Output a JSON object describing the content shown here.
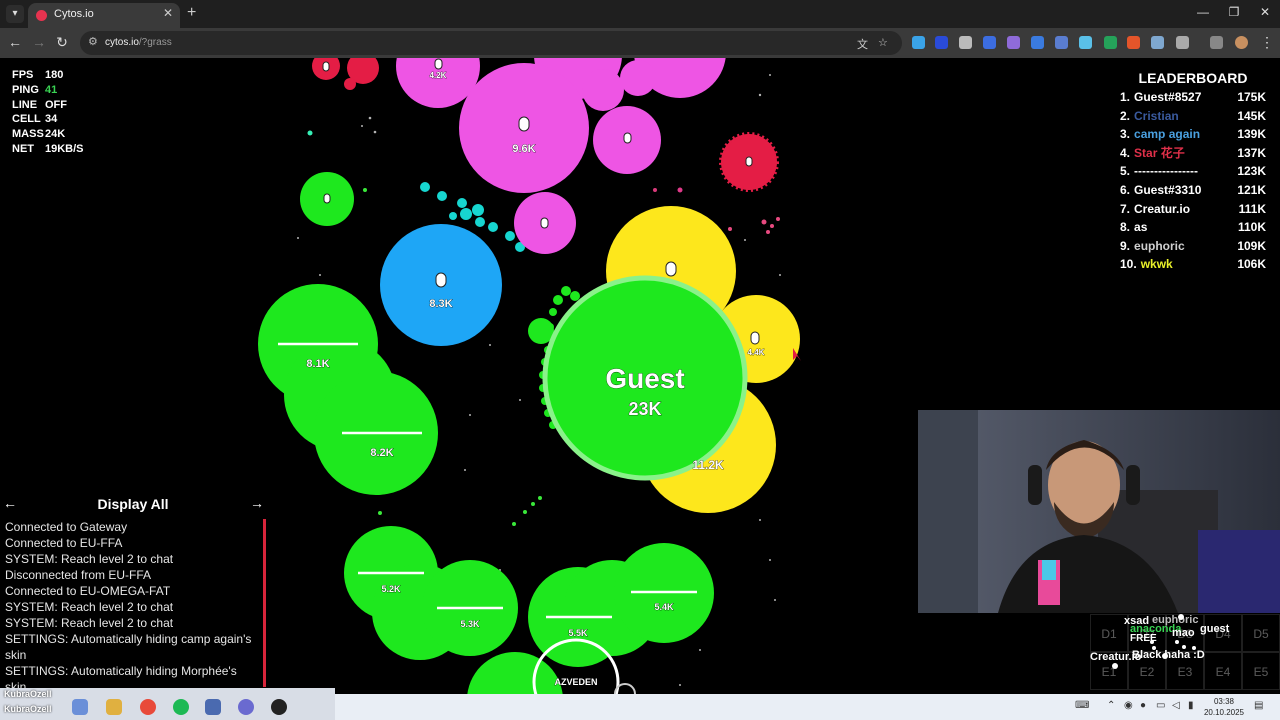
{
  "browser": {
    "tab_title": "Cytos.io",
    "tab_close": "✕",
    "new_tab": "+",
    "url_host": "cytos.io",
    "url_path": "/?grass",
    "back": "←",
    "forward": "→",
    "reload": "↻",
    "minimize": "—",
    "restore": "❐",
    "close": "✕"
  },
  "stats": [
    {
      "label": "FPS",
      "value": "180"
    },
    {
      "label": "PING",
      "value": "41"
    },
    {
      "label": "LINE",
      "value": "OFF"
    },
    {
      "label": "CELL",
      "value": "34"
    },
    {
      "label": "MASS",
      "value": "24K"
    },
    {
      "label": "NET",
      "value": "19KB/S"
    }
  ],
  "leaderboard": {
    "title": "LEADERBOARD",
    "entries": [
      {
        "rank": "1.",
        "name": "Guest#8527",
        "score": "175K",
        "color": "#ffffff"
      },
      {
        "rank": "2.",
        "name": "Cristian",
        "score": "145K",
        "color": "#3a5a9e"
      },
      {
        "rank": "3.",
        "name": "camp again",
        "score": "139K",
        "color": "#4aa0e0"
      },
      {
        "rank": "4.",
        "name": "Star 花子",
        "score": "137K",
        "color": "#e0304a"
      },
      {
        "rank": "5.",
        "name": "----------------",
        "score": "123K",
        "color": "#ffffff"
      },
      {
        "rank": "6.",
        "name": "Guest#3310",
        "score": "121K",
        "color": "#ffffff"
      },
      {
        "rank": "7.",
        "name": "Creatur.io",
        "score": "111K",
        "color": "#ffffff"
      },
      {
        "rank": "8.",
        "name": "as",
        "score": "110K",
        "color": "#ffffff"
      },
      {
        "rank": "9.",
        "name": "euphoric",
        "score": "109K",
        "color": "#cfcfcf"
      },
      {
        "rank": "10.",
        "name": "wkwk",
        "score": "106K",
        "color": "#e8f02a"
      }
    ]
  },
  "chat": {
    "title": "Display All",
    "prev": "←",
    "next": "→",
    "lines": [
      "Connected to Gateway",
      "Connected to EU-FFA",
      "SYSTEM: Reach level 2 to chat",
      "Disconnected from EU-FFA",
      "Connected to EU-OMEGA-FAT",
      "SYSTEM: Reach level 2 to chat",
      "SYSTEM: Reach level 2 to chat",
      "SETTINGS: Automatically hiding camp again's skin",
      "SETTINGS: Automatically hiding Morphée's skin"
    ]
  },
  "player": {
    "name": "Guest",
    "mass": "23K"
  },
  "cells": [
    {
      "label": "9.6K"
    },
    {
      "label": "8.3K"
    },
    {
      "label": "8.1K"
    },
    {
      "label": "8.2K"
    },
    {
      "label": "5.2K"
    },
    {
      "label": "5.3K"
    },
    {
      "label": "5.5K"
    },
    {
      "label": "5.4K"
    },
    {
      "label": "11.2K"
    },
    {
      "label": "4.4K"
    },
    {
      "label": "4.2K"
    },
    {
      "label": "AZVEDEN"
    }
  ],
  "minimap": {
    "cells": [
      "D1",
      "D2",
      "D3",
      "D4",
      "D5",
      "E1",
      "E2",
      "E3",
      "E4",
      "E5"
    ],
    "names": [
      "xsad",
      "euphoric",
      "anaconda",
      "guest",
      "mao",
      "Black haha :D",
      "Creatur.io",
      "FREE"
    ]
  },
  "taskbar": {
    "users": [
      "KubraOzell",
      "KubraOzell"
    ],
    "time": "03:38",
    "date": "20.10.2025"
  },
  "colors": {
    "green": "#1ee81e",
    "magenta": "#ee55e4",
    "blue": "#1ea6f6",
    "yellow": "#fde71c",
    "red": "#e41d45",
    "cyan": "#17d6d0"
  }
}
